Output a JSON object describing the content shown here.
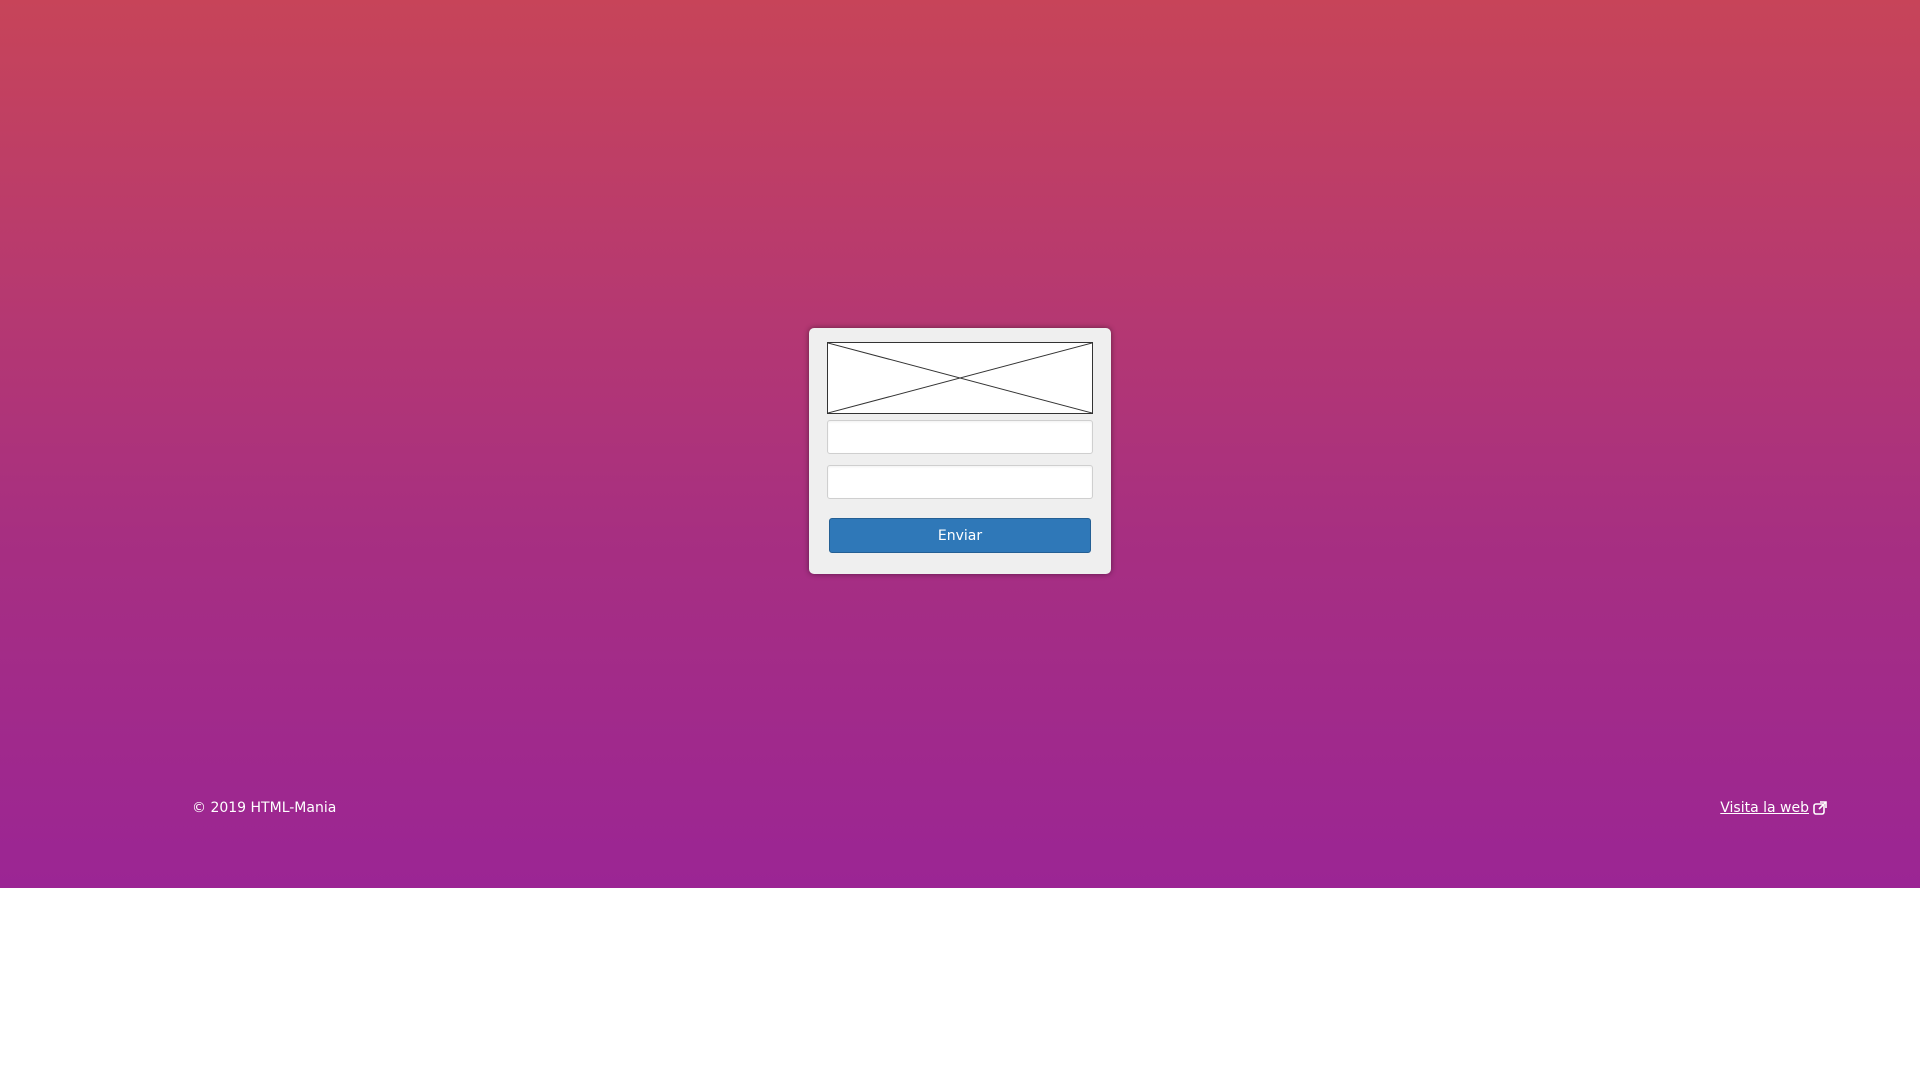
{
  "colors": {
    "gradient_top": "#c74459",
    "gradient_bottom": "#9b2594",
    "card_background": "#efefef",
    "button_background": "#2f78b8",
    "footer_text": "#ffffff"
  },
  "login": {
    "logo_icon": "broken-image-placeholder",
    "username_value": "",
    "password_value": "",
    "submit_label": "Enviar"
  },
  "footer": {
    "copyright": "© 2019 HTML-Mania",
    "visit_link_label": "Visita la web",
    "visit_link_icon": "external-link-icon"
  }
}
